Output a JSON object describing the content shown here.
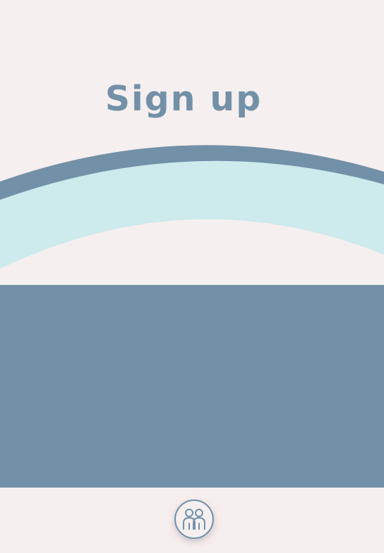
{
  "page": {
    "title": "Sign up"
  },
  "colors": {
    "background": "#f6efef",
    "primary": "#7291a8",
    "accent_light": "#cdeaec"
  },
  "footer": {
    "icon": "users-icon"
  }
}
